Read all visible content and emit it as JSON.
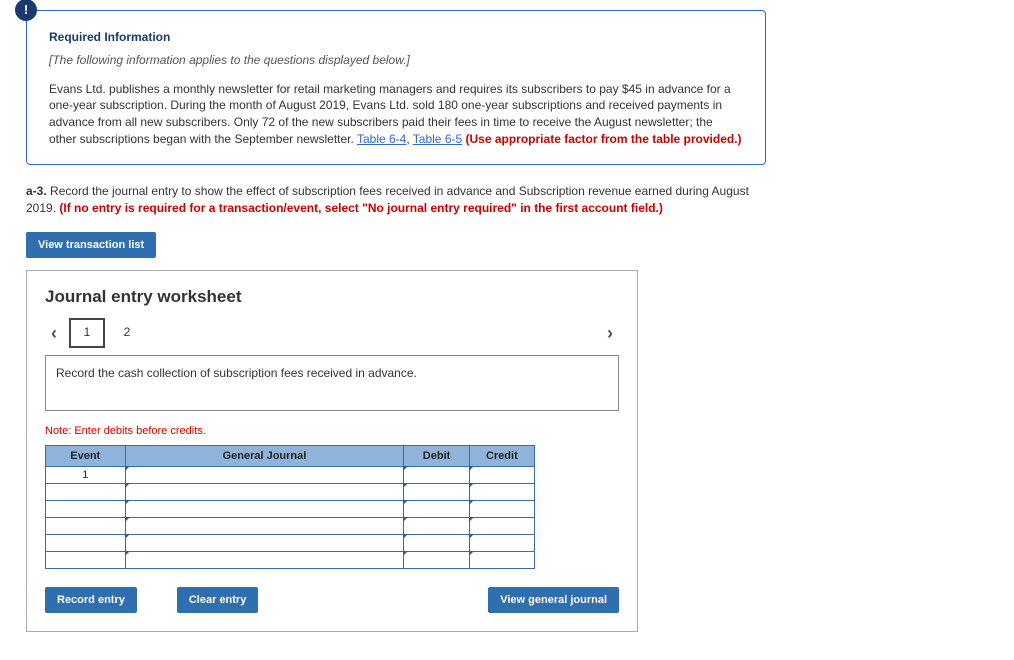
{
  "info_badge": "!",
  "required_title": "Required Information",
  "applies_text": "[The following information applies to the questions displayed below.]",
  "body_text_1": "Evans Ltd. publishes a monthly newsletter for retail marketing managers and requires its subscribers to pay $45 in advance for a one-year subscription. During the month of August 2019, Evans Ltd. sold 180 one-year subscriptions and received payments in advance from all new subscribers. Only 72 of the new subscribers paid their fees in time to receive the August newsletter; the other subscriptions began with the September newsletter. ",
  "link_1": "Table 6-4",
  "sep": ", ",
  "link_2": "Table 6-5",
  "body_red": " (Use appropriate factor from the table provided.)",
  "question_prefix": "a-3.",
  "question_text": " Record the journal entry to show the effect of subscription fees received in advance and Subscription revenue earned during August 2019. ",
  "question_red": "(If no entry is required for a transaction/event, select \"No journal entry required\" in the first account field.)",
  "view_txn": "View transaction list",
  "ws_title": "Journal entry worksheet",
  "pages": [
    "1",
    "2"
  ],
  "active_page": 0,
  "instruction": "Record the cash collection of subscription fees received in advance.",
  "note": "Note: Enter debits before credits.",
  "headers": {
    "event": "Event",
    "gj": "General Journal",
    "debit": "Debit",
    "credit": "Credit"
  },
  "event_num": "1",
  "btn_record": "Record entry",
  "btn_clear": "Clear entry",
  "btn_viewgj": "View general journal"
}
